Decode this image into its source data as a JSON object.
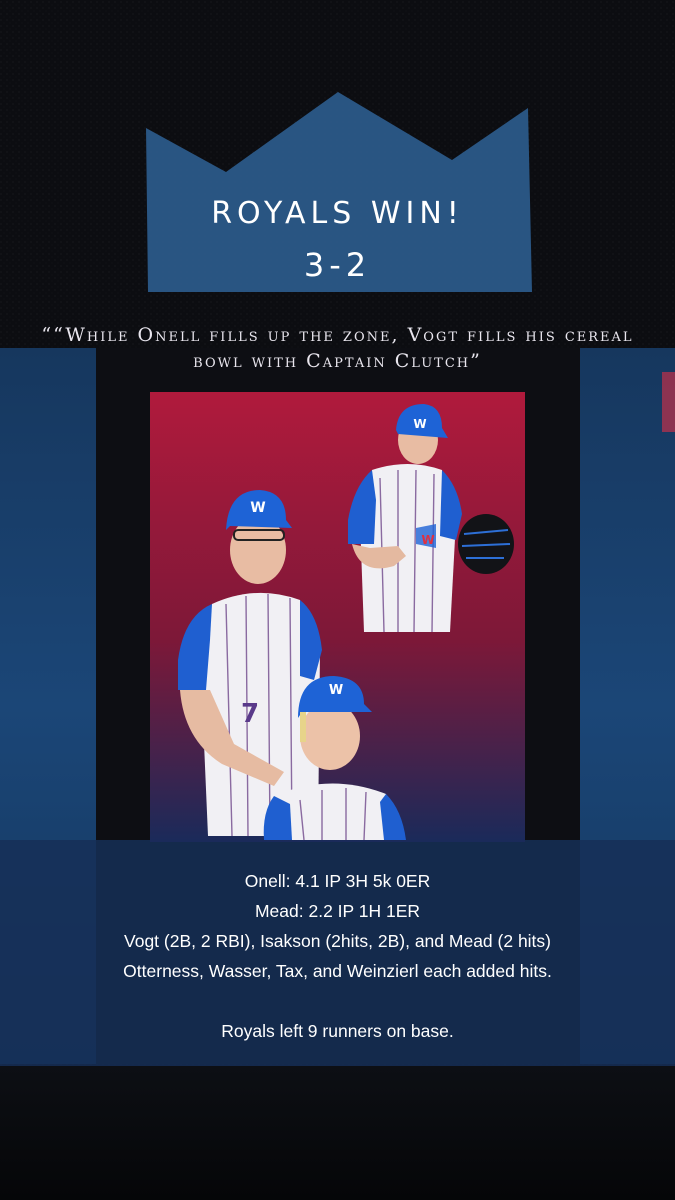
{
  "graphic": {
    "headline": "ROYALS WIN!",
    "score": "3-2",
    "quote": "““While Onell fills up the zone, Vogt fills his cereal bowl with Captain Clutch”",
    "stat_lines": [
      "Onell: 4.1 IP 3H 5k 0ER",
      "Mead: 2.2 IP 1H 1ER",
      "Vogt (2B, 2 RBI), Isakson (2hits, 2B), and Mead (2 hits)",
      "Otterness, Wasser, Tax, and Weinzierl each added hits."
    ],
    "note": "Royals left 9 runners on base.",
    "jersey_number": "7",
    "cap_logo": "W"
  },
  "colors": {
    "background": "#0b0c10",
    "crown_blue": "#2d5d8e",
    "frame_red": "#a81a3a",
    "panel_blue": "#173f6c",
    "jersey_blue": "#1f5fd0",
    "text": "#ffffff"
  }
}
